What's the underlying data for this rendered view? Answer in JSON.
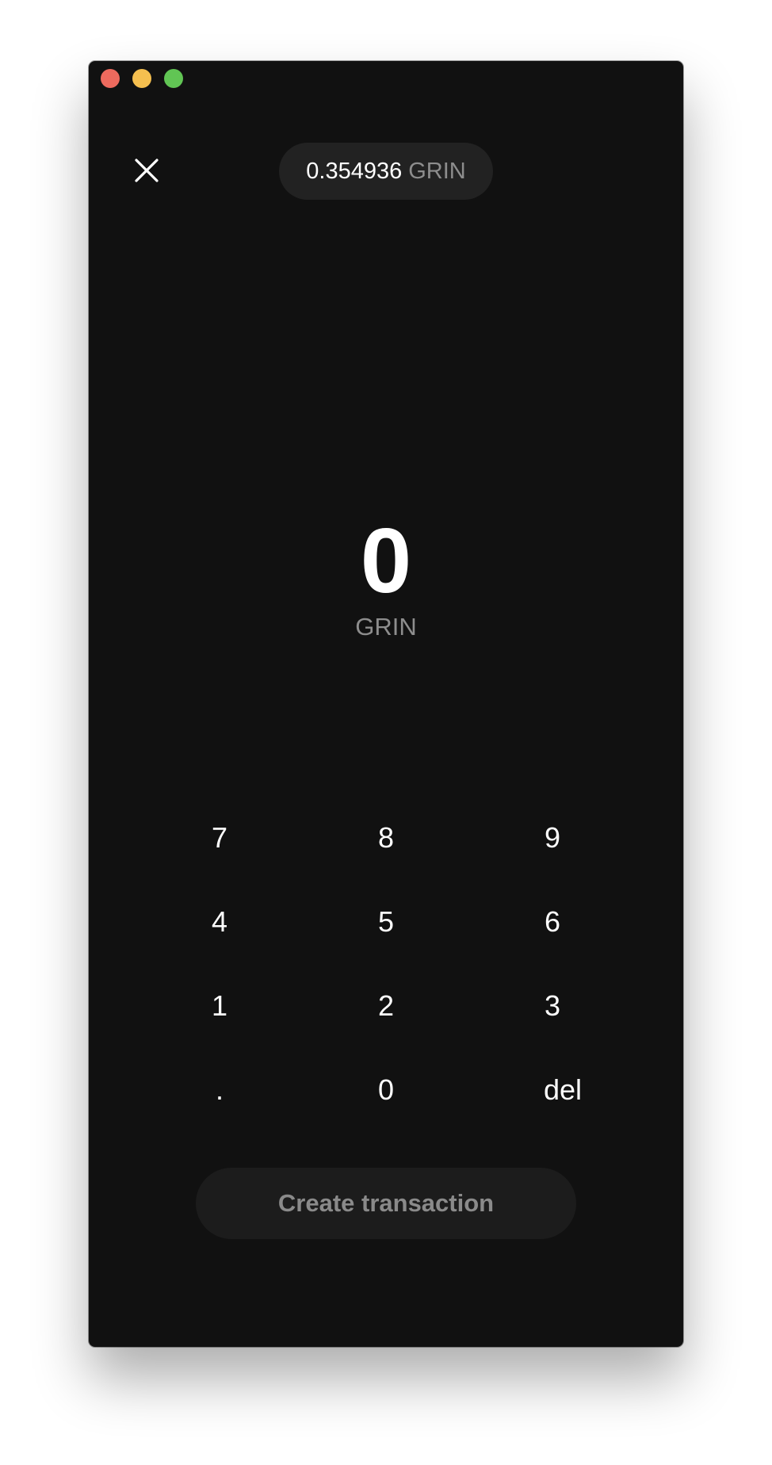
{
  "window": {
    "traffic_lights": [
      "close",
      "minimize",
      "zoom"
    ]
  },
  "header": {
    "close_icon": "close-icon",
    "balance": {
      "amount": "0.354936",
      "unit": "GRIN"
    }
  },
  "amount": {
    "value": "0",
    "unit": "GRIN"
  },
  "keypad": {
    "keys": [
      "7",
      "8",
      "9",
      "4",
      "5",
      "6",
      "1",
      "2",
      "3",
      ".",
      "0",
      "del"
    ]
  },
  "actions": {
    "create_label": "Create transaction"
  },
  "colors": {
    "background": "#111111",
    "pill": "#222222",
    "button": "#1c1c1c",
    "muted_text": "#8d8d8d",
    "text": "#ffffff"
  }
}
